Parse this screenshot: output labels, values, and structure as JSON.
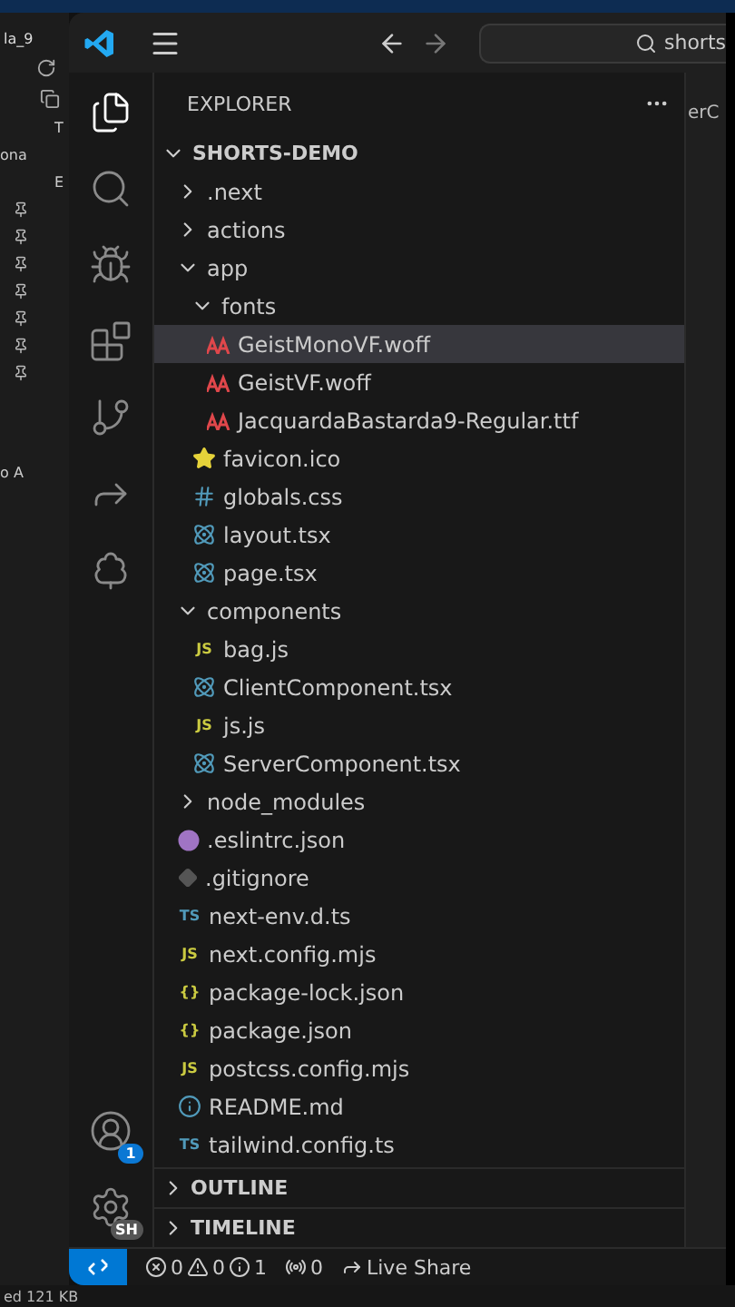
{
  "background_window": {
    "tab": "la_9",
    "labels": [
      "T",
      "E"
    ],
    "side_text": "ona",
    "lower_text": "o A",
    "status": "ed 121 KB"
  },
  "title_bar": {
    "search": "shorts"
  },
  "activity_bar": {
    "items": [
      {
        "kind": "files",
        "selected": true
      },
      {
        "kind": "search",
        "selected": false
      },
      {
        "kind": "debug",
        "selected": false
      },
      {
        "kind": "extensions",
        "selected": false
      },
      {
        "kind": "git",
        "selected": false
      },
      {
        "kind": "share",
        "selected": false
      },
      {
        "kind": "tree",
        "selected": false
      }
    ],
    "account_badge": "1",
    "settings_badge": "SH"
  },
  "sidebar": {
    "title": "EXPLORER",
    "root": "SHORTS-DEMO",
    "items": [
      {
        "label": ".next",
        "kind": "folder",
        "expanded": false,
        "selected": false
      },
      {
        "label": "actions",
        "kind": "folder",
        "expanded": false,
        "selected": false
      },
      {
        "label": "app",
        "kind": "folder",
        "expanded": true,
        "selected": false,
        "children": [
          {
            "label": "fonts",
            "kind": "folder",
            "expanded": true,
            "selected": false,
            "children": [
              {
                "label": "GeistMonoVF.woff",
                "kind": "font",
                "selected": true
              },
              {
                "label": "GeistVF.woff",
                "kind": "font",
                "selected": false
              },
              {
                "label": "JacquardaBastarda9-Regular.ttf",
                "kind": "font",
                "selected": false
              }
            ]
          },
          {
            "label": "favicon.ico",
            "kind": "star",
            "selected": false
          },
          {
            "label": "globals.css",
            "kind": "hash",
            "selected": false
          },
          {
            "label": "layout.tsx",
            "kind": "react",
            "selected": false
          },
          {
            "label": "page.tsx",
            "kind": "react",
            "selected": false
          }
        ]
      },
      {
        "label": "components",
        "kind": "folder",
        "expanded": true,
        "selected": false,
        "children": [
          {
            "label": "bag.js",
            "kind": "js",
            "icon_text": "JS",
            "selected": false
          },
          {
            "label": "ClientComponent.tsx",
            "kind": "react",
            "selected": false
          },
          {
            "label": "js.js",
            "kind": "js",
            "icon_text": "JS",
            "selected": false
          },
          {
            "label": "ServerComponent.tsx",
            "kind": "react",
            "selected": false
          }
        ]
      },
      {
        "label": "node_modules",
        "kind": "folder",
        "expanded": false,
        "selected": false
      },
      {
        "label": ".eslintrc.json",
        "kind": "eslint",
        "selected": false
      },
      {
        "label": ".gitignore",
        "kind": "git",
        "selected": false
      },
      {
        "label": "next-env.d.ts",
        "kind": "ts",
        "icon_text": "TS",
        "selected": false
      },
      {
        "label": "next.config.mjs",
        "kind": "js",
        "icon_text": "JS",
        "selected": false
      },
      {
        "label": "package-lock.json",
        "kind": "json",
        "icon_text": "{}",
        "selected": false
      },
      {
        "label": "package.json",
        "kind": "json",
        "icon_text": "{}",
        "selected": false
      },
      {
        "label": "postcss.config.mjs",
        "kind": "js",
        "icon_text": "JS",
        "selected": false
      },
      {
        "label": "README.md",
        "kind": "info",
        "selected": false
      },
      {
        "label": "tailwind.config.ts",
        "kind": "ts",
        "icon_text": "TS",
        "selected": false
      }
    ],
    "sections": [
      {
        "label": "OUTLINE",
        "expanded": false
      },
      {
        "label": "TIMELINE",
        "expanded": false
      }
    ]
  },
  "editor_tab": "erC",
  "status_bar": {
    "errors": "0",
    "warnings": "0",
    "infos": "1",
    "ports": "0",
    "live_share": "Live Share"
  }
}
